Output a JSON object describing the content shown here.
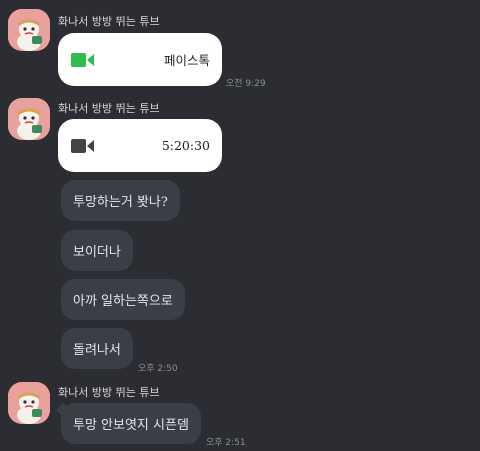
{
  "messages": [
    {
      "sender": "화나서 방방 뛰는 튜브",
      "call": {
        "label": "페이스톡",
        "icon": "facetalk-video-icon",
        "color": "#2dbe4e"
      },
      "time": "오전 9:29"
    },
    {
      "sender": "화나서 방방 뛰는 튜브",
      "call": {
        "label": "5:20:30",
        "icon": "video-call-icon",
        "color": "#444444"
      },
      "texts": [
        "투망하는거 봣나?",
        "보이더나",
        "아까 일하는쪽으로",
        "돌려나서"
      ],
      "time": "오후 2:50"
    },
    {
      "sender": "화나서 방방 뛰는 튜브",
      "texts": [
        "투망 안보엿지 시픈뎀"
      ],
      "time": "오후 2:51"
    }
  ],
  "colors": {
    "background": "#2b2d33",
    "bubble": "#3c3e45",
    "avatar_bg": "#e8a19c"
  }
}
